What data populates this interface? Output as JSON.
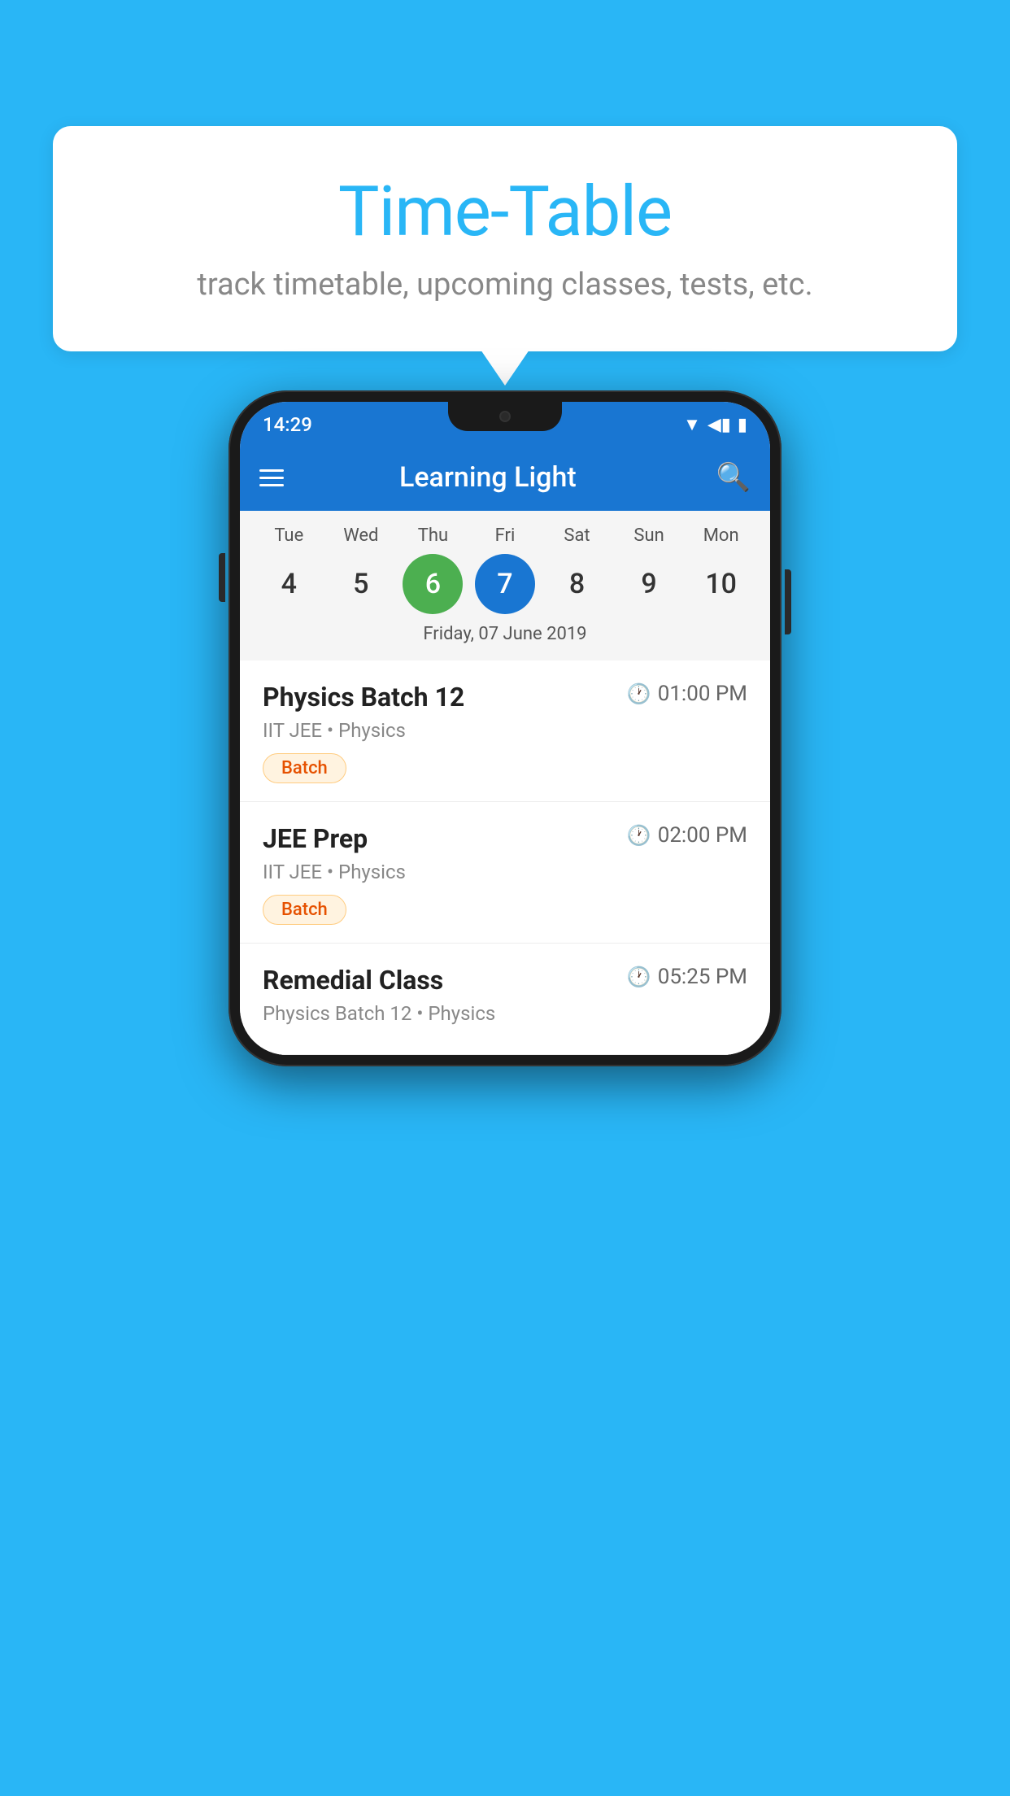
{
  "background_color": "#29B6F6",
  "bubble": {
    "title": "Time-Table",
    "subtitle": "track timetable, upcoming classes, tests, etc."
  },
  "phone": {
    "status_bar": {
      "time": "14:29"
    },
    "app_bar": {
      "title": "Learning Light"
    },
    "calendar": {
      "days": [
        {
          "label": "Tue",
          "num": "4"
        },
        {
          "label": "Wed",
          "num": "5"
        },
        {
          "label": "Thu",
          "num": "6",
          "state": "today"
        },
        {
          "label": "Fri",
          "num": "7",
          "state": "selected"
        },
        {
          "label": "Sat",
          "num": "8"
        },
        {
          "label": "Sun",
          "num": "9"
        },
        {
          "label": "Mon",
          "num": "10"
        }
      ],
      "selected_date": "Friday, 07 June 2019"
    },
    "schedule": [
      {
        "title": "Physics Batch 12",
        "time": "01:00 PM",
        "meta": "IIT JEE • Physics",
        "badge": "Batch"
      },
      {
        "title": "JEE Prep",
        "time": "02:00 PM",
        "meta": "IIT JEE • Physics",
        "badge": "Batch"
      },
      {
        "title": "Remedial Class",
        "time": "05:25 PM",
        "meta": "Physics Batch 12 • Physics",
        "badge": null
      }
    ]
  }
}
